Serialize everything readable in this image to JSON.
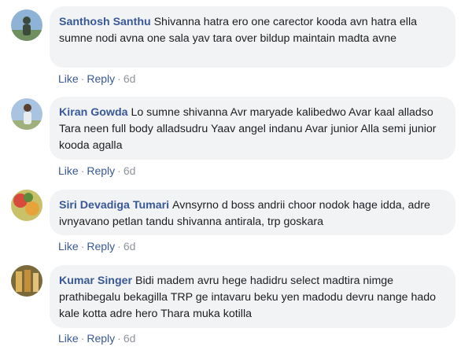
{
  "comments": [
    {
      "author": "Santhosh Santhu",
      "text": "Shivanna hatra ero one carector kooda avn hatra ella sumne nodi avna one sala yav tara over bildup maintain madta avne",
      "like_label": "Like",
      "reply_label": "Reply",
      "separator": "·",
      "time": "6d",
      "avatar_colors": [
        "#8fb3d6",
        "#3b4a3a"
      ]
    },
    {
      "author": "Kiran Gowda",
      "text": "Lo sumne shivanna Avr maryade kalibedwo Avar kaal alladso Tara neen full body alladsudru Yaav angel indanu Avar junior Alla semi junior kooda agalla",
      "like_label": "Like",
      "reply_label": "Reply",
      "separator": "·",
      "time": "6d",
      "avatar_colors": [
        "#a9c4e0",
        "#e9ecef"
      ]
    },
    {
      "author": "Siri Devadiga Tumari",
      "text": "Avnsyrno d boss andrii choor nodok hage idda, adre ivnyavano petlan tandu shivanna antirala, trp goskara",
      "like_label": "Like",
      "reply_label": "Reply",
      "separator": "·",
      "time": "6d",
      "avatar_colors": [
        "#c9c16a",
        "#d64b3c"
      ]
    },
    {
      "author": "Kumar Singer",
      "text": "Bidi madem avru hege hadidru select madtira nimge prathibegalu bekagilla TRP ge intavaru beku yen madodu devru nange hado kale kotta adre hero Thara muka kotilla",
      "like_label": "Like",
      "reply_label": "Reply",
      "separator": "·",
      "time": "6d",
      "avatar_colors": [
        "#7a6a3a",
        "#d9b25a"
      ]
    }
  ]
}
